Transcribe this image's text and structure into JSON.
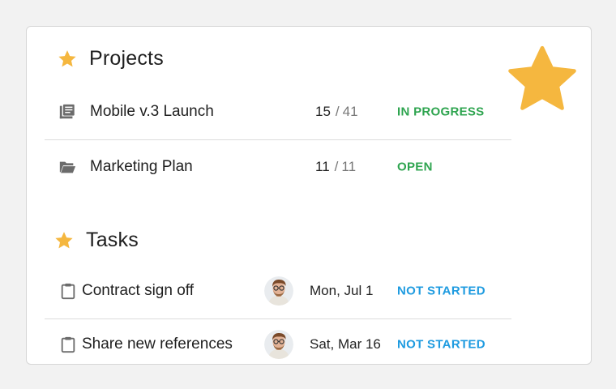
{
  "colors": {
    "star": "#F5B73F",
    "in_progress": "#2EA44F",
    "open": "#2EA44F",
    "not_started": "#1E9BE0",
    "icon_gray": "#6b6b6b"
  },
  "projects": {
    "title": "Projects",
    "title_icon": "star-icon",
    "items": [
      {
        "icon": "document-stack-icon",
        "name": "Mobile v.3 Launch",
        "done": "15",
        "separator": "/",
        "total": "41",
        "status": "IN PROGRESS"
      },
      {
        "icon": "folder-open-icon",
        "name": "Marketing Plan",
        "done": "11",
        "separator": "/",
        "total": "11",
        "status": "OPEN"
      }
    ]
  },
  "tasks": {
    "title": "Tasks",
    "title_icon": "star-icon",
    "items": [
      {
        "icon": "clipboard-icon",
        "name": "Contract sign off",
        "assignee_icon": "avatar",
        "date": "Mon, Jul 1",
        "status": "NOT STARTED"
      },
      {
        "icon": "clipboard-icon",
        "name": "Share new references",
        "assignee_icon": "avatar",
        "date": "Sat, Mar 16",
        "status": "NOT STARTED"
      }
    ]
  },
  "decoration": {
    "icon": "favorite-star-icon"
  }
}
